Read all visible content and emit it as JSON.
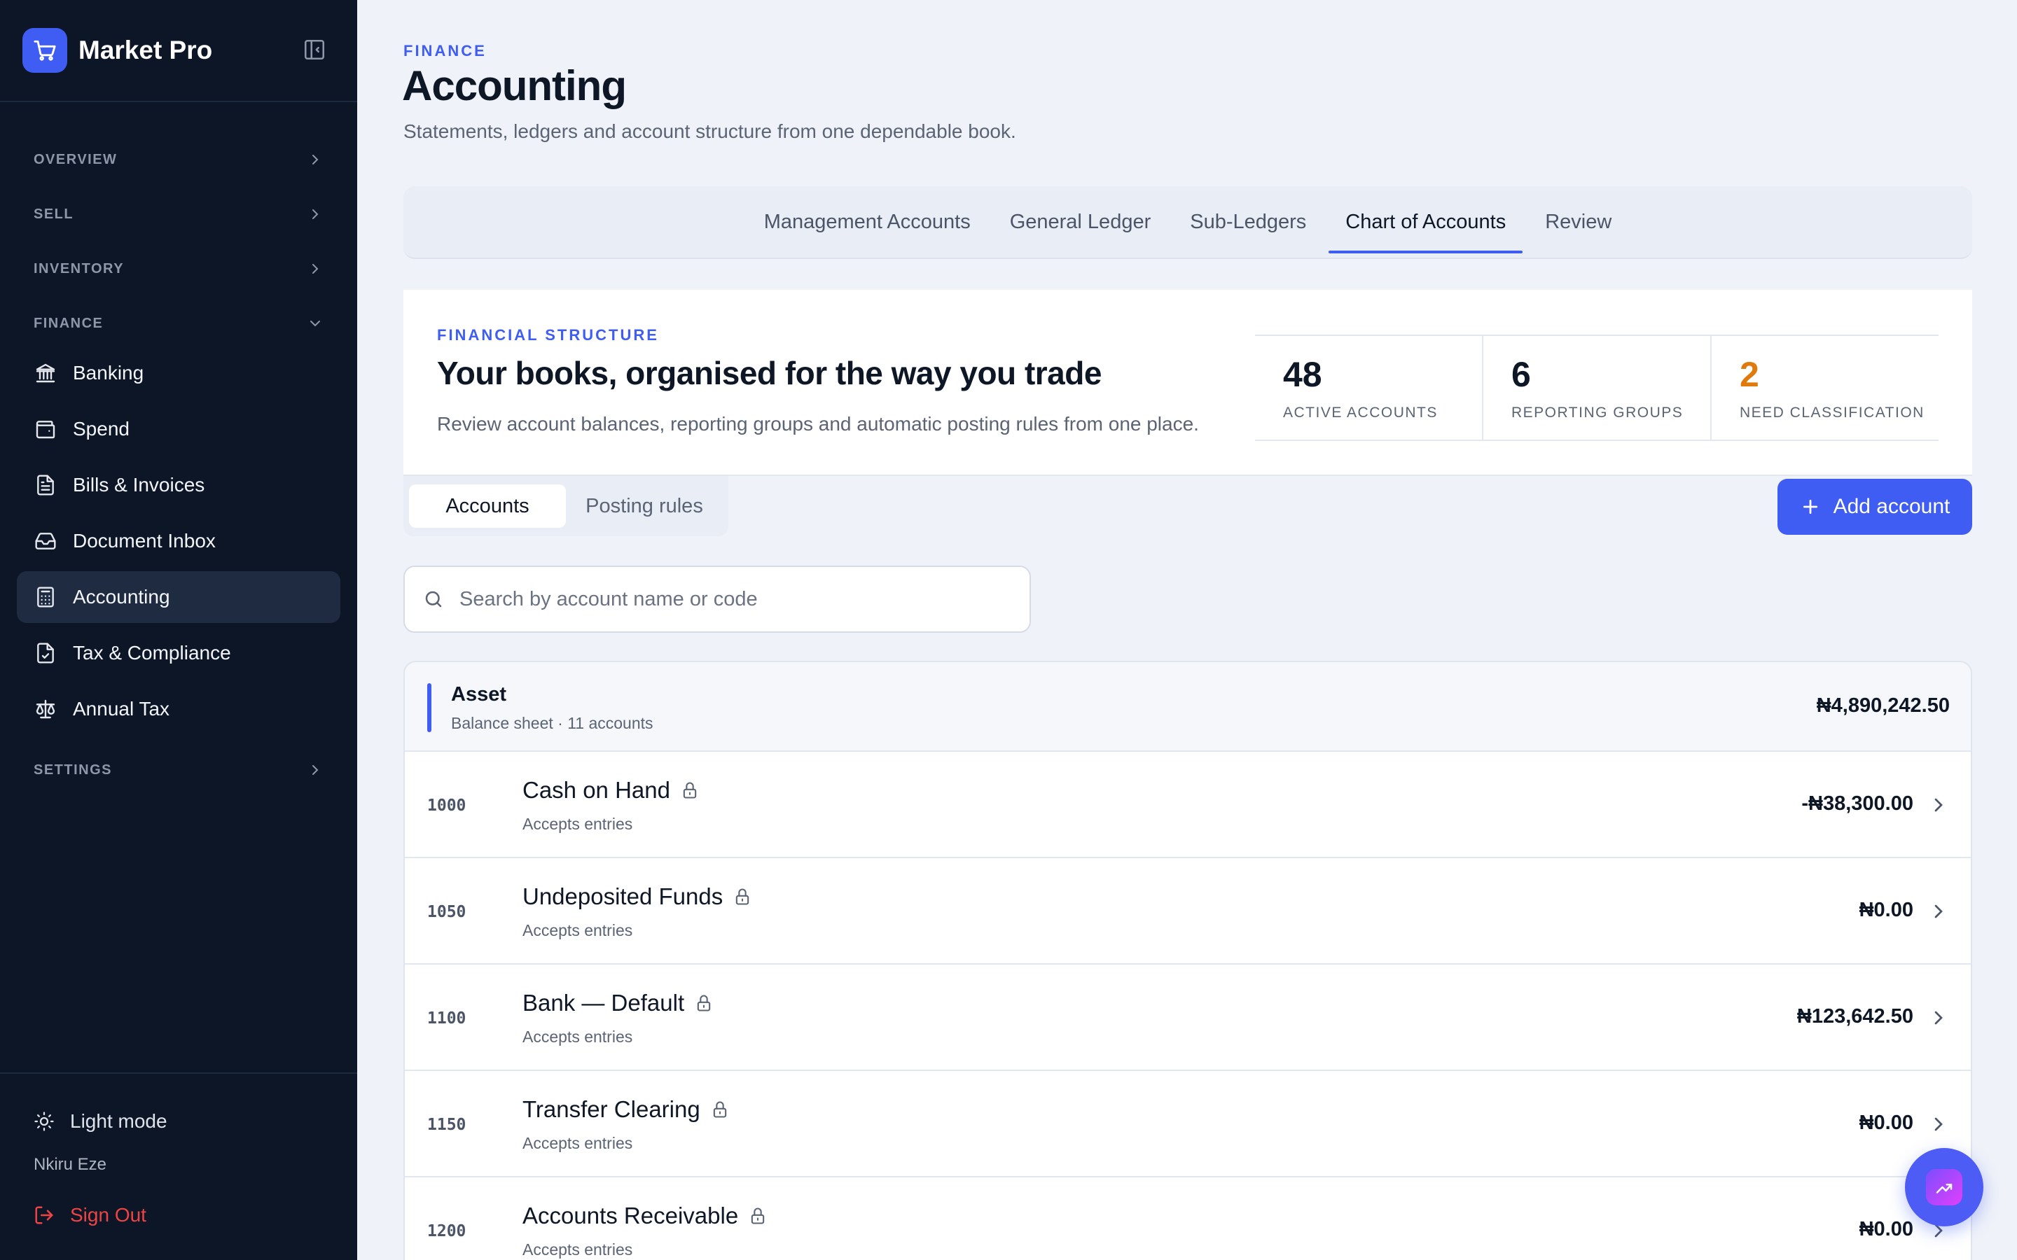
{
  "app": {
    "name": "Market Pro"
  },
  "sidebar": {
    "sections": {
      "overview": "OVERVIEW",
      "sell": "SELL",
      "inventory": "INVENTORY",
      "finance": "FINANCE",
      "settings": "SETTINGS"
    },
    "items": [
      {
        "label": "Banking",
        "icon": "bank-icon"
      },
      {
        "label": "Spend",
        "icon": "wallet-icon"
      },
      {
        "label": "Bills & Invoices",
        "icon": "receipt-icon"
      },
      {
        "label": "Document Inbox",
        "icon": "inbox-icon"
      },
      {
        "label": "Accounting",
        "icon": "calculator-icon",
        "active": true
      },
      {
        "label": "Tax & Compliance",
        "icon": "document-check-icon"
      },
      {
        "label": "Annual Tax",
        "icon": "scale-icon"
      }
    ],
    "light_mode": "Light mode",
    "user": "Nkiru Eze",
    "sign_out": "Sign Out"
  },
  "header": {
    "eyebrow": "FINANCE",
    "title": "Accounting",
    "subtitle": "Statements, ledgers and account structure from one dependable book."
  },
  "tabs": [
    {
      "label": "Management Accounts"
    },
    {
      "label": "General Ledger"
    },
    {
      "label": "Sub-Ledgers"
    },
    {
      "label": "Chart of Accounts",
      "active": true
    },
    {
      "label": "Review"
    }
  ],
  "summary": {
    "eyebrow": "FINANCIAL STRUCTURE",
    "title": "Your books, organised for the way you trade",
    "description": "Review account balances, reporting groups and automatic posting rules from one place.",
    "stats": [
      {
        "value": "48",
        "label": "ACTIVE ACCOUNTS"
      },
      {
        "value": "6",
        "label": "REPORTING GROUPS"
      },
      {
        "value": "2",
        "label": "NEED CLASSIFICATION",
        "color": "#e07b0b"
      }
    ]
  },
  "segment": {
    "accounts": "Accounts",
    "posting_rules": "Posting rules"
  },
  "add_account": "Add account",
  "search": {
    "placeholder": "Search by account name or code"
  },
  "group": {
    "name": "Asset",
    "meta": "Balance sheet · 11 accounts",
    "total": "₦4,890,242.50"
  },
  "accounts": [
    {
      "code": "1000",
      "name": "Cash on Hand",
      "sub": "Accepts entries",
      "balance": "-₦38,300.00"
    },
    {
      "code": "1050",
      "name": "Undeposited Funds",
      "sub": "Accepts entries",
      "balance": "₦0.00"
    },
    {
      "code": "1100",
      "name": "Bank — Default",
      "sub": "Accepts entries",
      "balance": "₦123,642.50"
    },
    {
      "code": "1150",
      "name": "Transfer Clearing",
      "sub": "Accepts entries",
      "balance": "₦0.00"
    },
    {
      "code": "1200",
      "name": "Accounts Receivable",
      "sub": "Accepts entries",
      "balance": "₦0.00"
    }
  ],
  "colors": {
    "accent": "#3f5df2",
    "sidebar_bg": "#0d1626",
    "warning": "#e07b0b",
    "danger": "#ef4444"
  }
}
